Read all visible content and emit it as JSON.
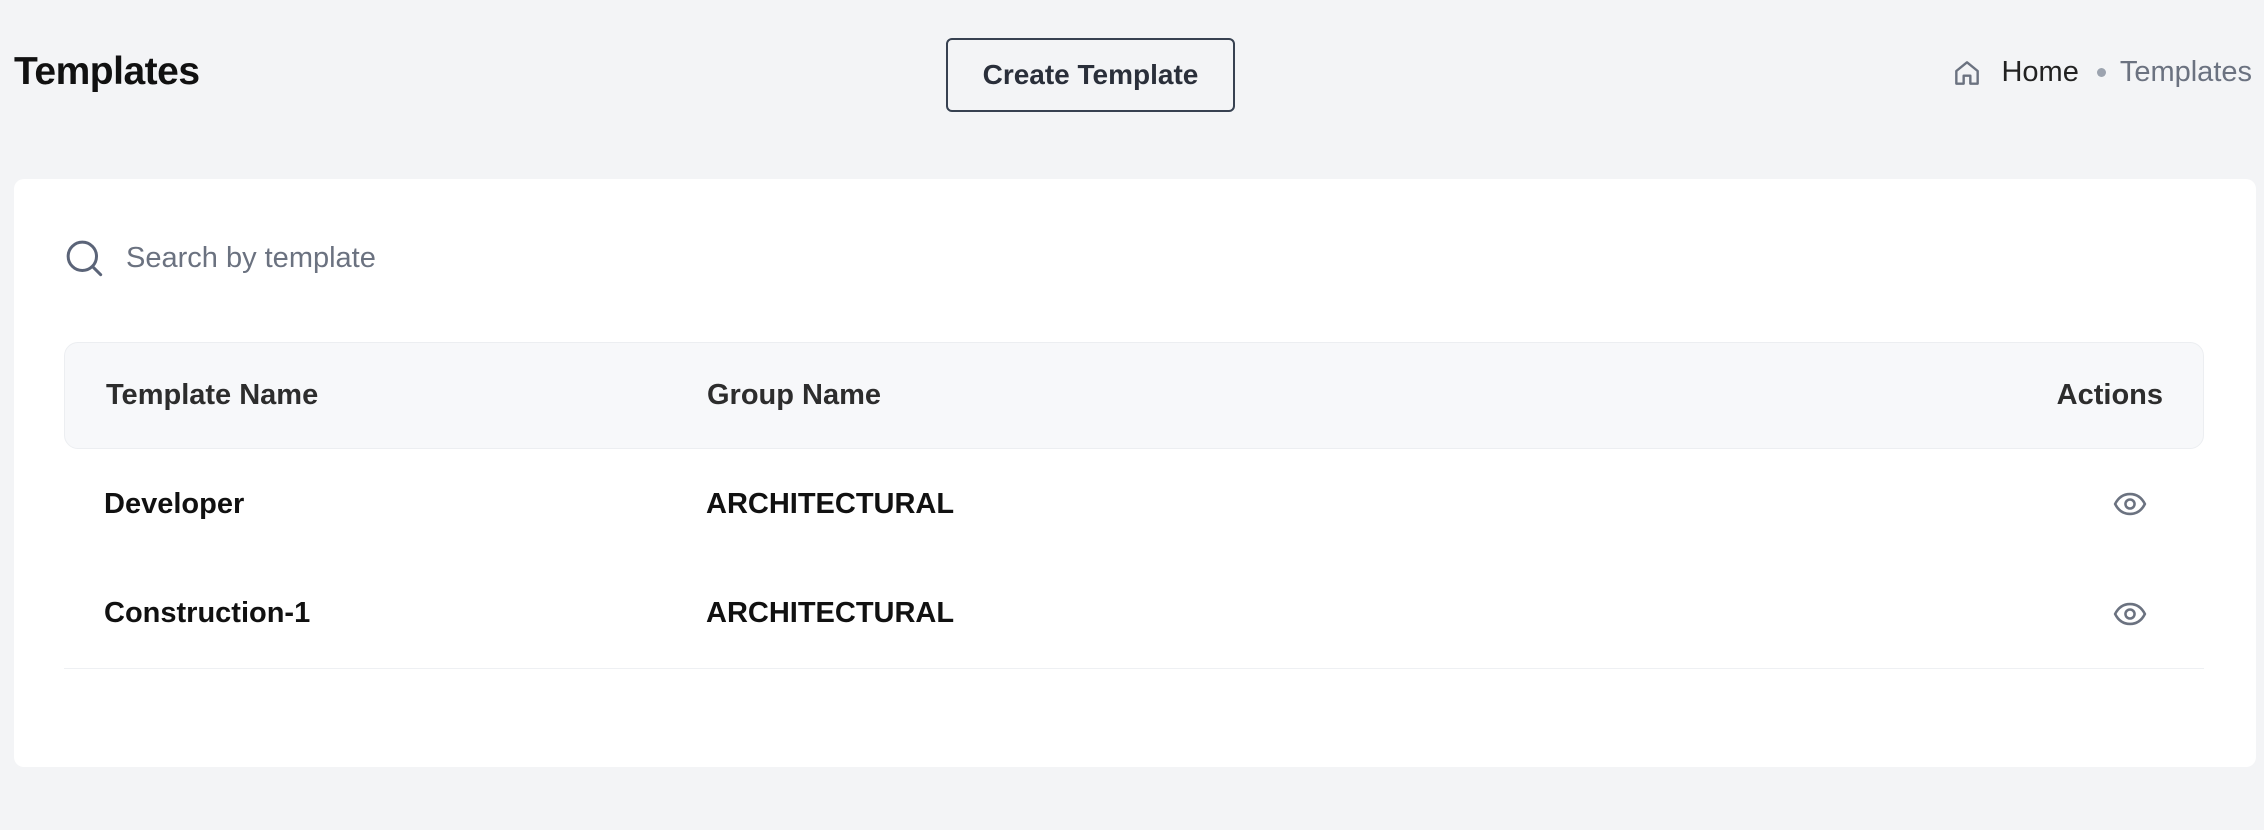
{
  "header": {
    "title": "Templates",
    "create_button_label": "Create Template"
  },
  "breadcrumb": {
    "home_label": "Home",
    "current_label": "Templates",
    "home_icon": "home-icon"
  },
  "search": {
    "placeholder": "Search by template ı",
    "value": "",
    "icon": "search-icon"
  },
  "table": {
    "columns": [
      "Template Name",
      "Group Name",
      "Actions"
    ],
    "rows": [
      {
        "template_name": "Developer",
        "group_name": "ARCHITECTURAL",
        "action_icon": "eye-icon"
      },
      {
        "template_name": "Construction-1",
        "group_name": "ARCHITECTURAL",
        "action_icon": "eye-icon"
      }
    ]
  },
  "colors": {
    "background": "#f3f4f6",
    "card": "#ffffff",
    "header_row": "#f7f8fa",
    "muted_text": "#6b7280",
    "icon_gray": "#6b7280"
  }
}
